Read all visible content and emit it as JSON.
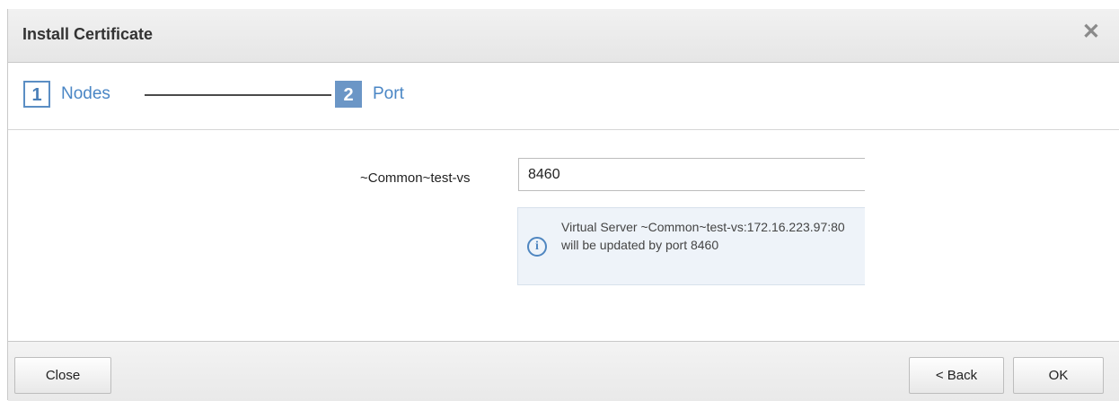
{
  "dialog": {
    "title": "Install Certificate",
    "close_glyph": "✕"
  },
  "wizard": {
    "steps": [
      {
        "number": "1",
        "label": "Nodes",
        "state": "completed"
      },
      {
        "number": "2",
        "label": "Port",
        "state": "active"
      }
    ]
  },
  "form": {
    "field_label": "~Common~test-vs",
    "port_value": "8460",
    "info_icon": "info-circle-icon",
    "info_text": "Virtual Server ~Common~test-vs:172.16.223.97:80 will be updated by port 8460"
  },
  "footer": {
    "close_label": "Close",
    "back_label": "< Back",
    "ok_label": "OK"
  },
  "colors": {
    "accent": "#4a86c5",
    "active_step": "#6b96c6",
    "info_bg": "#eef3f9"
  }
}
